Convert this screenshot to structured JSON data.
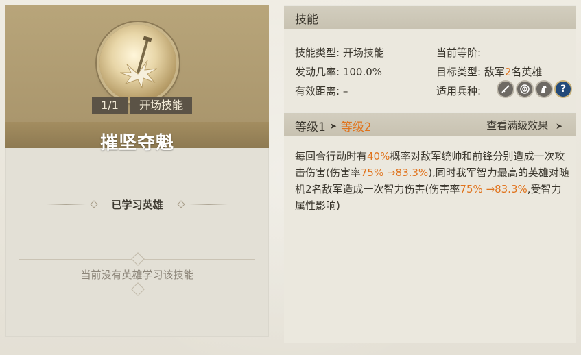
{
  "skill": {
    "name": "摧坚夺魁",
    "level_badge": "1/1",
    "type_badge": "开场技能"
  },
  "left": {
    "learned_title": "已学习英雄",
    "empty_text": "当前没有英雄学习该技能"
  },
  "panel": {
    "title": "技能",
    "info": {
      "skill_type_label": "技能类型:",
      "skill_type_value": "开场技能",
      "current_level_label": "当前等阶:",
      "current_level_value": "",
      "trigger_rate_label": "发动几率:",
      "trigger_rate_value": "100.0%",
      "target_type_label": "目标类型:",
      "target_type_prefix": "敌军",
      "target_type_num": "2",
      "target_type_suffix": "名英雄",
      "range_label": "有效距离:",
      "range_value": "–",
      "troop_label": "适用兵种:"
    },
    "troop_icons": [
      "sword-icon",
      "target-icon",
      "horse-icon",
      "question-icon"
    ],
    "levels": {
      "level1": "等级1",
      "level2": "等级2",
      "view_max": "查看满级效果"
    },
    "desc": {
      "p1": "每回合行动时有",
      "chance": "40%",
      "p2": "概率对敌军统帅和前锋分别造成一次攻击伤害(伤害率",
      "dmg1": "75% →83.3%",
      "p3": "),同时我军智力最高的英雄对随机2名敌军造成一次智力伤害(伤害率",
      "dmg2": "75% →83.3%",
      "p4": ",受智力属性影响)"
    }
  },
  "colors": {
    "accent_orange": "#e0731c",
    "gold": "#a7936a"
  }
}
